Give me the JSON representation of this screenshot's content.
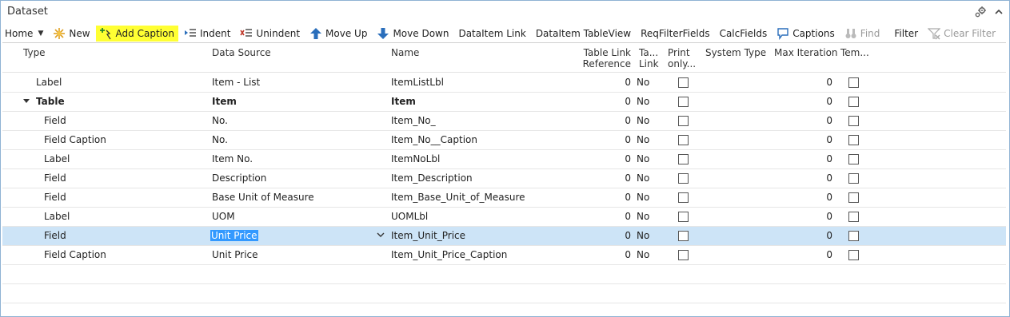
{
  "window": {
    "title": "Dataset"
  },
  "toolbar": {
    "home": "Home",
    "new": "New",
    "add_caption": "Add Caption",
    "indent": "Indent",
    "unindent": "Unindent",
    "move_up": "Move Up",
    "move_down": "Move Down",
    "dataitem_link": "DataItem Link",
    "dataitem_tableview": "DataItem TableView",
    "reqfilterfields": "ReqFilterFields",
    "calcfields": "CalcFields",
    "captions": "Captions",
    "find": "Find",
    "filter": "Filter",
    "clear_filter": "Clear Filter"
  },
  "columns": {
    "type": "Type",
    "data_source": "Data Source",
    "name": "Name",
    "table_link_reference_1": "Table Link",
    "table_link_reference_2": "Reference",
    "ta_link_1": "Ta...",
    "ta_link_2": "Link",
    "print_only_1": "Print",
    "print_only_2": "only...",
    "system_type": "System Type",
    "max_iteration": "Max Iteration",
    "tem": "Tem..."
  },
  "rows": [
    {
      "type": "Label",
      "source": "Item - List",
      "name": "ItemListLbl",
      "ref": "0",
      "link": "No",
      "maxit": "0"
    },
    {
      "type": "Table",
      "source": "Item",
      "name": "Item",
      "ref": "0",
      "link": "No",
      "maxit": "0"
    },
    {
      "type": "Field",
      "source": "No.",
      "name": "Item_No_",
      "ref": "0",
      "link": "No",
      "maxit": "0"
    },
    {
      "type": "Field Caption",
      "source": "No.",
      "name": "Item_No__Caption",
      "ref": "0",
      "link": "No",
      "maxit": "0"
    },
    {
      "type": "Label",
      "source": "Item No.",
      "name": "ItemNoLbl",
      "ref": "0",
      "link": "No",
      "maxit": "0"
    },
    {
      "type": "Field",
      "source": "Description",
      "name": "Item_Description",
      "ref": "0",
      "link": "No",
      "maxit": "0"
    },
    {
      "type": "Field",
      "source": "Base Unit of Measure",
      "name": "Item_Base_Unit_of_Measure",
      "ref": "0",
      "link": "No",
      "maxit": "0"
    },
    {
      "type": "Label",
      "source": "UOM",
      "name": "UOMLbl",
      "ref": "0",
      "link": "No",
      "maxit": "0"
    },
    {
      "type": "Field",
      "source": "Unit Price",
      "name": "Item_Unit_Price",
      "ref": "0",
      "link": "No",
      "maxit": "0"
    },
    {
      "type": "Field Caption",
      "source": "Unit Price",
      "name": "Item_Unit_Price_Caption",
      "ref": "0",
      "link": "No",
      "maxit": "0"
    }
  ],
  "colors": {
    "highlight": "#ffff33",
    "selected_row": "#cde4f7",
    "text_selection": "#3399ff",
    "accent": "#2a6ebb"
  }
}
